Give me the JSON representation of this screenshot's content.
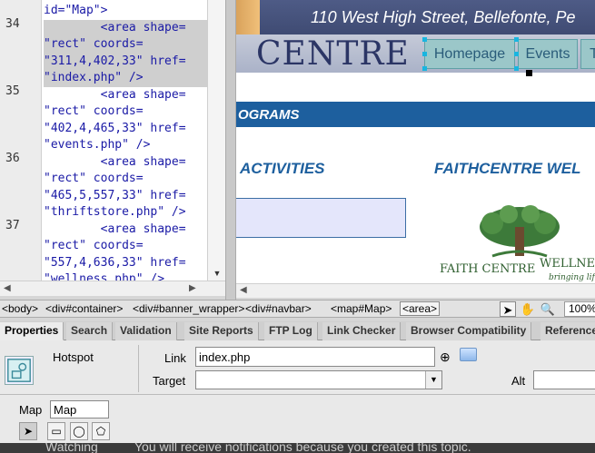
{
  "code": {
    "top_line": "id=\"Map\">",
    "line_numbers": [
      "34",
      "35",
      "36",
      "37"
    ],
    "lines": [
      "        <area shape=",
      "\"rect\" coords=",
      "\"311,4,402,33\" href=",
      "\"index.php\" />",
      "        <area shape=",
      "\"rect\" coords=",
      "\"402,4,465,33\" href=",
      "\"events.php\" />",
      "        <area shape=",
      "\"rect\" coords=",
      "\"465,5,557,33\" href=",
      "\"thriftstore.php\" />",
      "        <area shape=",
      "\"rect\" coords=",
      "\"557,4,636,33\" href=",
      "\"wellness.php\" />"
    ]
  },
  "design": {
    "address": "110 West High Street, Bellefonte, Pe",
    "logo_text": "CENTRE",
    "nav": [
      "Homepage",
      "Events",
      "T"
    ],
    "programs_heading": "OGRAMS",
    "activities_heading": "ACTIVITIES",
    "faith_heading": "FAITHCENTRE WEL",
    "tree_logo_text": "FAITH CENTRE",
    "tree_logo_text2": "WELLNE",
    "tree_tagline": "bringing life"
  },
  "tag_selector": {
    "tags": [
      "<body>",
      "<div#container>",
      "<div#banner_wrapper>",
      "<div#navbar>",
      "<map#Map>",
      "<area>"
    ],
    "zoom": "100%"
  },
  "panel_tabs": [
    "Properties",
    "Search",
    "Validation",
    "Site Reports",
    "FTP Log",
    "Link Checker",
    "Browser Compatibility",
    "Reference"
  ],
  "properties": {
    "type_label": "Hotspot",
    "link_label": "Link",
    "link_value": "index.php",
    "target_label": "Target",
    "alt_label": "Alt",
    "map_label": "Map",
    "map_value": "Map"
  },
  "bottom_strip": {
    "watch_text": "Watching",
    "note_text": "You will receive notifications because you created this topic."
  },
  "icons": {
    "hotspot": "hotspot-icon",
    "point_to_file": "point-to-file-icon",
    "folder": "folder-icon",
    "pointer": "pointer-icon",
    "hand": "hand-icon",
    "zoom": "zoom-icon"
  },
  "colors": {
    "banner": "#46527c",
    "nav_button": "#9bc7c9",
    "programs_bar": "#1d5f9e",
    "heading_blue": "#1d5f9e",
    "selection_handle": "#19b5e0"
  }
}
